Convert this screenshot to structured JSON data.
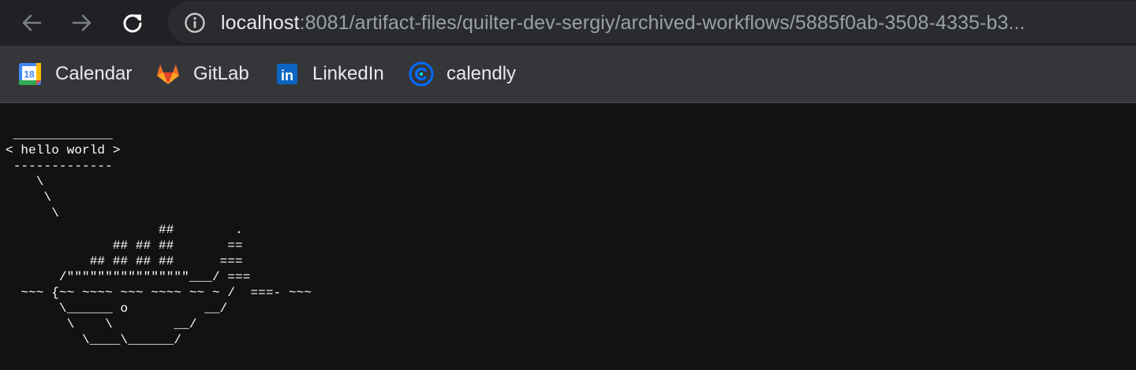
{
  "browser": {
    "nav": {
      "back_icon": "arrow-left-icon",
      "forward_icon": "arrow-right-icon",
      "reload_icon": "reload-icon"
    },
    "address_bar": {
      "info_icon": "info-circle-icon",
      "host": "localhost",
      "path": ":8081/artifact-files/quilter-dev-sergiy/archived-workflows/5885f0ab-3508-4335-b3..."
    },
    "bookmarks": [
      {
        "label": "Calendar",
        "icon": "google-calendar-icon",
        "icon_text": "18"
      },
      {
        "label": "GitLab",
        "icon": "gitlab-icon"
      },
      {
        "label": "LinkedIn",
        "icon": "linkedin-icon",
        "icon_text": "in"
      },
      {
        "label": "calendly",
        "icon": "calendly-icon"
      }
    ]
  },
  "page": {
    "cowsay_output": " _____________\n< hello world >\n -------------\n    \\\n     \\\n      \\\n                    ##        .\n              ## ## ##       ==\n           ## ## ## ##      ===\n       /\"\"\"\"\"\"\"\"\"\"\"\"\"\"\"\"___/ ===\n  ~~~ {~~ ~~~~ ~~~ ~~~~ ~~ ~ /  ===- ~~~\n       \\______ o          __/\n        \\    \\        __/\n          \\____\\______/"
  },
  "colors": {
    "toolbar_bg": "#202124",
    "omnibox_bg": "#2a2b2e",
    "bookmarks_bg": "#35363a",
    "page_bg": "#121212",
    "text_primary": "#e8eaed",
    "text_secondary": "#9aa0a6"
  }
}
